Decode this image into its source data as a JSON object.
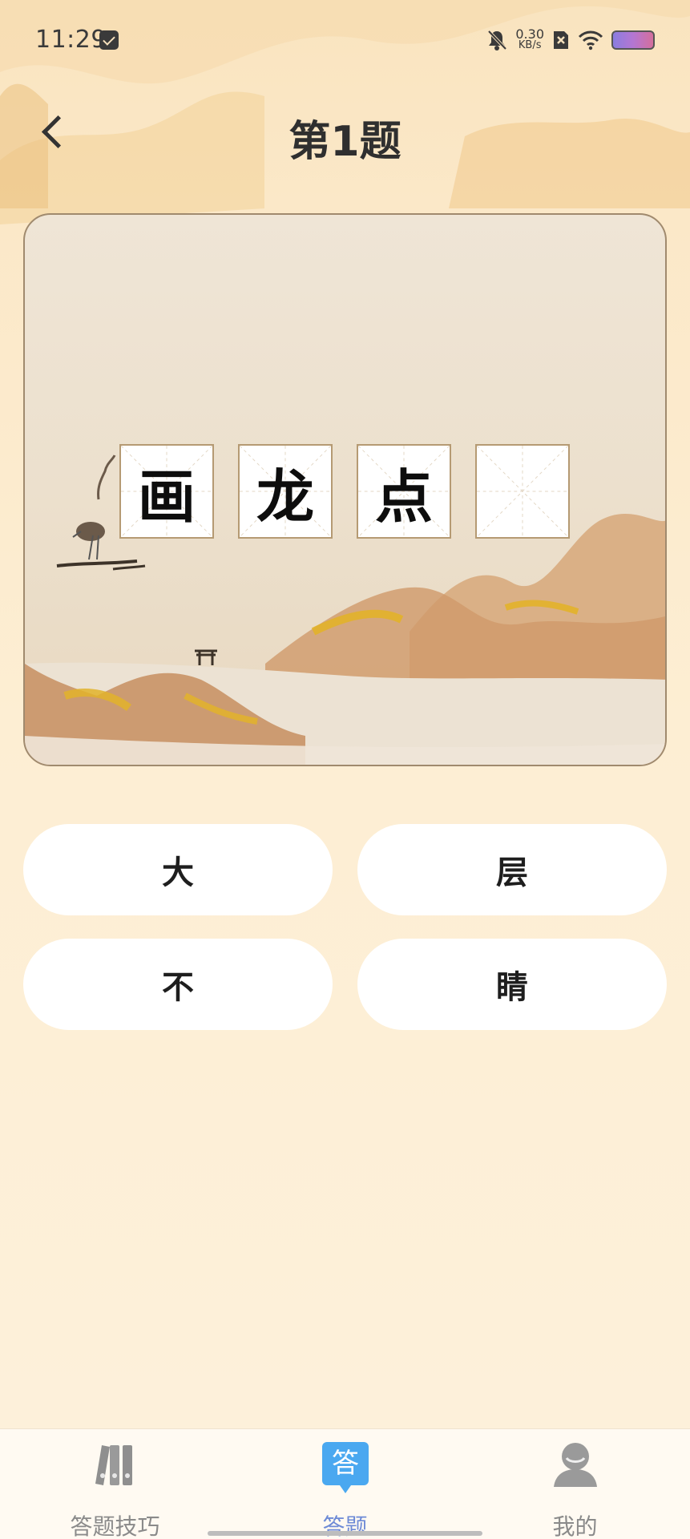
{
  "status_bar": {
    "time": "11:29",
    "net_speed_value": "0.30",
    "net_speed_unit": "KB/s"
  },
  "header": {
    "title": "第1题"
  },
  "puzzle": {
    "cells": [
      "画",
      "龙",
      "点",
      ""
    ]
  },
  "options": [
    "大",
    "层",
    "不",
    "睛"
  ],
  "bottom_nav": {
    "items": [
      {
        "label": "答题技巧",
        "icon": "books-icon",
        "active": false
      },
      {
        "label": "答题",
        "icon": "answer-icon",
        "icon_text": "答",
        "active": true
      },
      {
        "label": "我的",
        "icon": "profile-icon",
        "active": false
      }
    ]
  },
  "colors": {
    "background": "#fdefd6",
    "accent_blue": "#4aa8f0",
    "active_label": "#6d8ad6",
    "card_border": "#a08a6e"
  }
}
